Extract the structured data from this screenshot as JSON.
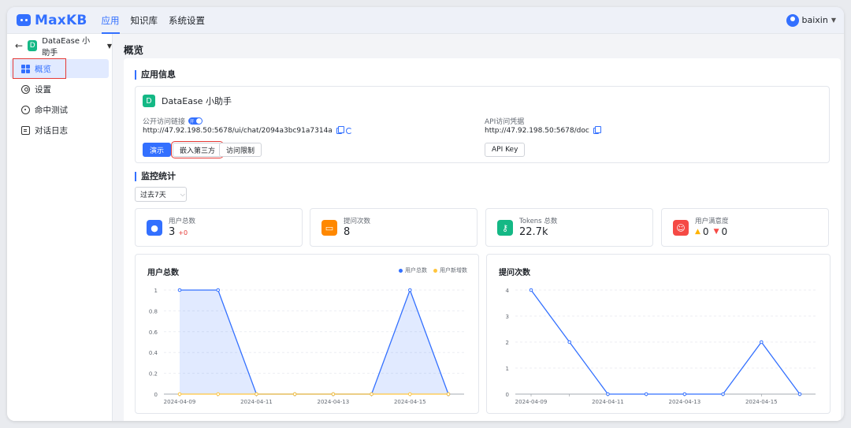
{
  "brand": {
    "name": "MaxKB",
    "color": "#3370ff"
  },
  "topnav": {
    "items": [
      {
        "label": "应用",
        "active": true
      },
      {
        "label": "知识库",
        "active": false
      },
      {
        "label": "系统设置",
        "active": false
      }
    ],
    "user": {
      "name": "baixin"
    }
  },
  "sidebar": {
    "app_initial": "D",
    "app_name": "DataEase 小助手",
    "items": [
      {
        "label": "概览",
        "icon": "dashboard-icon",
        "active": true
      },
      {
        "label": "设置",
        "icon": "settings-icon",
        "active": false
      },
      {
        "label": "命中测试",
        "icon": "hit-test-icon",
        "active": false
      },
      {
        "label": "对话日志",
        "icon": "log-icon",
        "active": false
      }
    ]
  },
  "page": {
    "title": "概览"
  },
  "app_info": {
    "section_title": "应用信息",
    "app_initial": "D",
    "app_name": "DataEase 小助手",
    "public_link_label": "公开访问链接",
    "toggle_label": "开",
    "public_link_url": "http://47.92.198.50:5678/ui/chat/2094a3bc91a7314a",
    "api_label": "API访问凭据",
    "api_url": "http://47.92.198.50:5678/doc",
    "buttons": {
      "demo": "演示",
      "embed": "嵌入第三方",
      "access": "访问限制",
      "api_key": "API Key"
    }
  },
  "monitor": {
    "section_title": "监控统计",
    "range_select": "过去7天",
    "stats": [
      {
        "label": "用户总数",
        "value": "3",
        "extra": "+0",
        "icon": "user-icon",
        "color": "#3370ff"
      },
      {
        "label": "提问次数",
        "value": "8",
        "icon": "message-icon",
        "color": "#ff8800"
      },
      {
        "label": "Tokens 总数",
        "value": "22.7k",
        "icon": "key-icon",
        "color": "#14b885"
      },
      {
        "label": "用户满意度",
        "like": "0",
        "dislike": "0",
        "icon": "satisfaction-icon",
        "color": "#f54a45"
      }
    ]
  },
  "chart_data": [
    {
      "type": "line",
      "title": "用户总数",
      "x_ticks": [
        "2024-04-09",
        "2024-04-11",
        "2024-04-13",
        "2024-04-15"
      ],
      "x": [
        "2024-04-09",
        "2024-04-10",
        "2024-04-11",
        "2024-04-12",
        "2024-04-13",
        "2024-04-14",
        "2024-04-15",
        "2024-04-16"
      ],
      "series": [
        {
          "name": "用户总数",
          "values": [
            1,
            1,
            0,
            0,
            0,
            0,
            1,
            0
          ],
          "color": "#3370ff",
          "area": true
        },
        {
          "name": "用户新增数",
          "values": [
            0,
            0,
            0,
            0,
            0,
            0,
            0,
            0
          ],
          "color": "#ffc53d"
        }
      ],
      "ylim": [
        0,
        1
      ],
      "y_ticks": [
        "0",
        "0.2",
        "0.4",
        "0.6",
        "0.8",
        "1"
      ],
      "legend": "top-right"
    },
    {
      "type": "line",
      "title": "提问次数",
      "x_ticks": [
        "2024-04-09",
        "2024-04-11",
        "2024-04-13",
        "2024-04-15"
      ],
      "x": [
        "2024-04-09",
        "2024-04-10",
        "2024-04-11",
        "2024-04-12",
        "2024-04-13",
        "2024-04-14",
        "2024-04-15",
        "2024-04-16"
      ],
      "series": [
        {
          "values": [
            4,
            2,
            0,
            0,
            0,
            0,
            2,
            0
          ],
          "color": "#3370ff"
        }
      ],
      "ylim": [
        0,
        4
      ],
      "y_ticks": [
        "0",
        "1",
        "2",
        "3",
        "4"
      ]
    }
  ]
}
